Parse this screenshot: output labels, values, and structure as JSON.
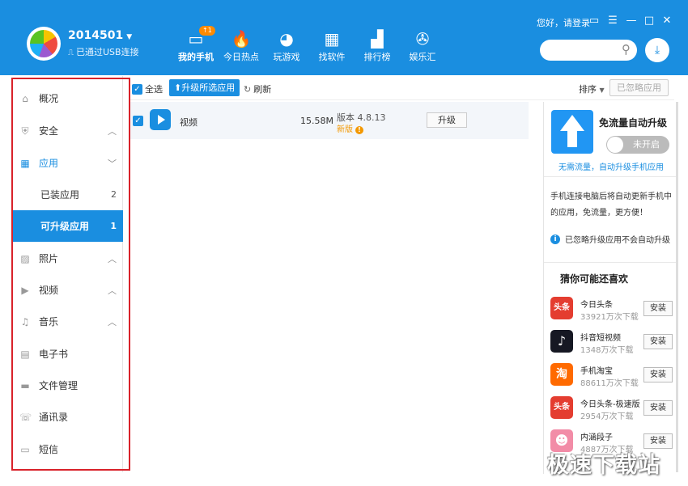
{
  "header": {
    "device_name": "2014501",
    "connection": "已通过USB连接",
    "greeting": "您好，请登录",
    "nav": [
      {
        "label": "我的手机",
        "icon": "phone-icon",
        "badge": "↑1",
        "active": true
      },
      {
        "label": "今日热点",
        "icon": "flame-icon"
      },
      {
        "label": "玩游戏",
        "icon": "gamepad-icon"
      },
      {
        "label": "找软件",
        "icon": "apps-grid-icon"
      },
      {
        "label": "排行榜",
        "icon": "bar-chart-icon"
      },
      {
        "label": "娱乐汇",
        "icon": "film-reel-icon"
      }
    ]
  },
  "sidebar": {
    "items": [
      {
        "label": "概况",
        "icon": "home-icon"
      },
      {
        "label": "安全",
        "icon": "shield-icon",
        "chevron": "up"
      },
      {
        "label": "应用",
        "icon": "apps-icon",
        "chevron": "down"
      },
      {
        "label": "已装应用",
        "count": "2"
      },
      {
        "label": "可升级应用",
        "count": "1"
      },
      {
        "label": "照片",
        "icon": "image-icon",
        "chevron": "up"
      },
      {
        "label": "视频",
        "icon": "video-icon",
        "chevron": "up"
      },
      {
        "label": "音乐",
        "icon": "music-icon",
        "chevron": "up"
      },
      {
        "label": "电子书",
        "icon": "book-icon"
      },
      {
        "label": "文件管理",
        "icon": "folder-icon"
      },
      {
        "label": "通讯录",
        "icon": "contacts-icon"
      },
      {
        "label": "短信",
        "icon": "sms-icon"
      }
    ]
  },
  "toolbar": {
    "select_all": "全选",
    "upgrade_selected": "升级所选应用",
    "refresh": "刷新",
    "sort": "排序",
    "ignored": "已忽略应用"
  },
  "apps": [
    {
      "name": "视频",
      "size": "15.58M",
      "version": "版本 4.8.13",
      "new_label": "新版",
      "action": "升级"
    }
  ],
  "right_panel": {
    "title": "免流量自动升级",
    "toggle": "未开启",
    "subtitle": "无需流量，自动升级手机应用",
    "description": "手机连接电脑后将自动更新手机中的应用，免流量，更方便！",
    "ignore_note": "已忽略升级应用不会自动升级",
    "rec_title": "猜你可能还喜欢",
    "recommendations": [
      {
        "name": "今日头条",
        "downloads": "33921万次下载",
        "action": "安装",
        "icon_text": "头条",
        "color": "#e43d30"
      },
      {
        "name": "抖音短视频",
        "downloads": "1348万次下载",
        "action": "安装",
        "icon_text": "♪",
        "color": "#161823"
      },
      {
        "name": "手机淘宝",
        "downloads": "88611万次下载",
        "action": "安装",
        "icon_text": "淘",
        "color": "#ff6a00"
      },
      {
        "name": "今日头条-极速版",
        "downloads": "2954万次下载",
        "action": "安装",
        "icon_text": "头条",
        "color": "#e43d30"
      },
      {
        "name": "内涵段子",
        "downloads": "4887万次下载",
        "action": "安装",
        "icon_text": "☻",
        "color": "#f28ca7"
      }
    ]
  },
  "watermark": "极速下载站"
}
